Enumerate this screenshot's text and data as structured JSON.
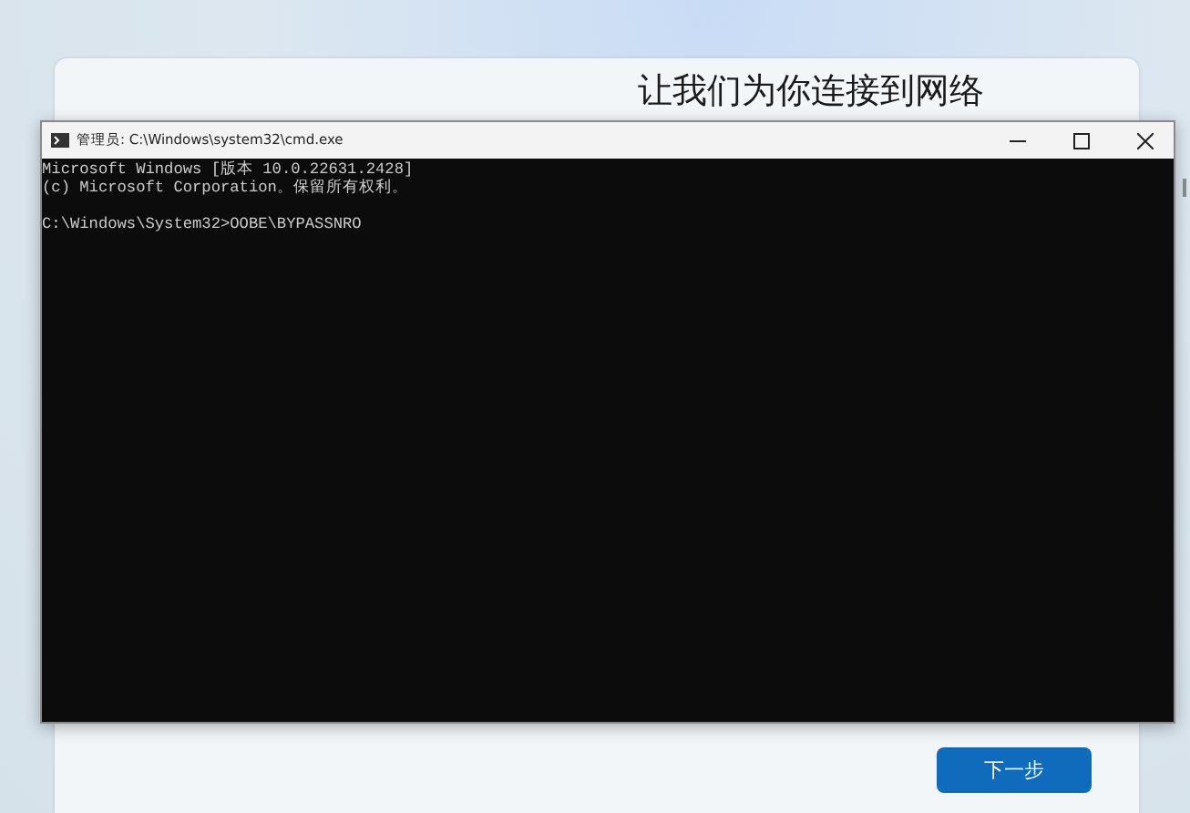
{
  "setup_page": {
    "heading": "让我们为你连接到网络",
    "next_button": "下一步"
  },
  "cmd_window": {
    "title": "管理员: C:\\Windows\\system32\\cmd.exe",
    "banner_lines": [
      "Microsoft Windows [版本 10.0.22631.2428]",
      "(c) Microsoft Corporation。保留所有权利。"
    ],
    "prompt_line": "C:\\Windows\\System32>OOBE\\BYPASSNRO"
  }
}
